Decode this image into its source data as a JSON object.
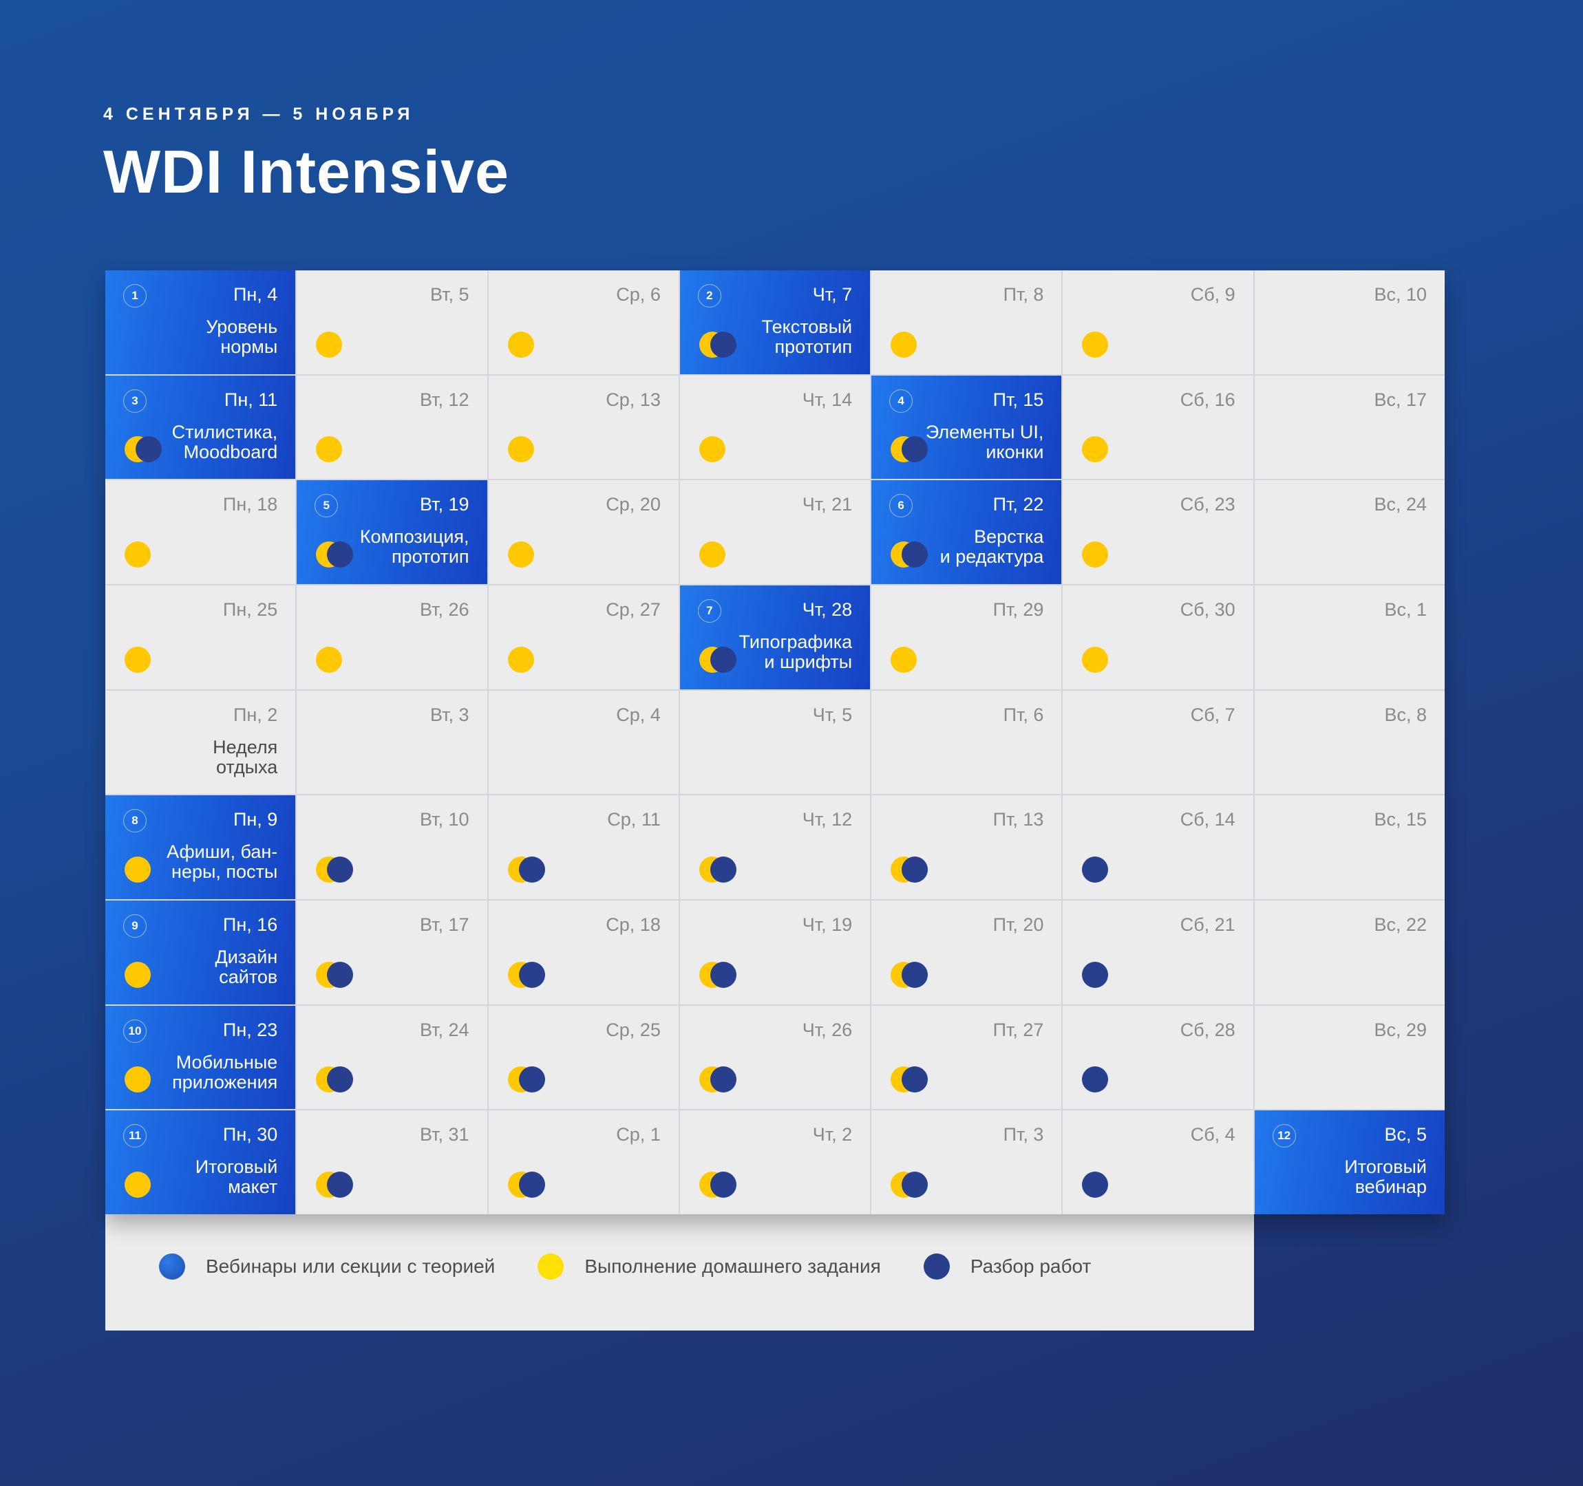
{
  "header": {
    "subtitle": "4 СЕНТЯБРЯ — 5 НОЯБРЯ",
    "title": "WDI Intensive"
  },
  "colors": {
    "lesson_bg": "#1a5ed9",
    "cell_bg": "#ececec",
    "homework_dot": "#ffc800",
    "review_dot": "#273f8c",
    "webinar_dot": "#1b5dc4"
  },
  "legend": [
    {
      "label": "Вебинары или секции с теорией",
      "icon": "webinar-dot"
    },
    {
      "label": "Выполнение домашнего задания",
      "icon": "homework-dot"
    },
    {
      "label": "Разбор работ",
      "icon": "review-dot"
    }
  ],
  "weeks": [
    [
      {
        "date": "Пн, 4",
        "lesson": true,
        "num": "1",
        "title": "Уровень\nнормы",
        "dots": ""
      },
      {
        "date": "Вт, 5",
        "dots": "y"
      },
      {
        "date": "Ср, 6",
        "dots": "y"
      },
      {
        "date": "Чт, 7",
        "lesson": true,
        "num": "2",
        "title": "Текстовый\nпрототип",
        "dots": "yb"
      },
      {
        "date": "Пт, 8",
        "dots": "y"
      },
      {
        "date": "Сб, 9",
        "dots": "y"
      },
      {
        "date": "Вс, 10",
        "dots": ""
      }
    ],
    [
      {
        "date": "Пн, 11",
        "lesson": true,
        "num": "3",
        "title": "Стилистика,\nMoodboard",
        "dots": "yb"
      },
      {
        "date": "Вт, 12",
        "dots": "y"
      },
      {
        "date": "Ср, 13",
        "dots": "y"
      },
      {
        "date": "Чт, 14",
        "dots": "y"
      },
      {
        "date": "Пт, 15",
        "lesson": true,
        "num": "4",
        "title": "Элементы UI,\nиконки",
        "dots": "yb"
      },
      {
        "date": "Сб, 16",
        "dots": "y"
      },
      {
        "date": "Вс, 17",
        "dots": ""
      }
    ],
    [
      {
        "date": "Пн, 18",
        "dots": "y"
      },
      {
        "date": "Вт, 19",
        "lesson": true,
        "num": "5",
        "title": "Композиция,\nпрототип",
        "dots": "yb"
      },
      {
        "date": "Ср, 20",
        "dots": "y"
      },
      {
        "date": "Чт, 21",
        "dots": "y"
      },
      {
        "date": "Пт, 22",
        "lesson": true,
        "num": "6",
        "title": "Верстка\nи редактура",
        "dots": "yb"
      },
      {
        "date": "Сб, 23",
        "dots": "y"
      },
      {
        "date": "Вс, 24",
        "dots": ""
      }
    ],
    [
      {
        "date": "Пн, 25",
        "dots": "y"
      },
      {
        "date": "Вт, 26",
        "dots": "y"
      },
      {
        "date": "Ср, 27",
        "dots": "y"
      },
      {
        "date": "Чт, 28",
        "lesson": true,
        "num": "7",
        "title": "Типографика\nи шрифты",
        "dots": "yb"
      },
      {
        "date": "Пт, 29",
        "dots": "y"
      },
      {
        "date": "Сб, 30",
        "dots": "y"
      },
      {
        "date": "Вс, 1",
        "dots": ""
      }
    ],
    [
      {
        "date": "Пн, 2",
        "rest": true,
        "title": "Неделя\nотдыха",
        "dots": ""
      },
      {
        "date": "Вт, 3",
        "dots": ""
      },
      {
        "date": "Ср, 4",
        "dots": ""
      },
      {
        "date": "Чт, 5",
        "dots": ""
      },
      {
        "date": "Пт, 6",
        "dots": ""
      },
      {
        "date": "Сб, 7",
        "dots": ""
      },
      {
        "date": "Вс, 8",
        "dots": ""
      }
    ],
    [
      {
        "date": "Пн, 9",
        "lesson": true,
        "num": "8",
        "title": "Афиши, бан-\nнеры, посты",
        "dots": "y"
      },
      {
        "date": "Вт, 10",
        "dots": "yb"
      },
      {
        "date": "Ср, 11",
        "dots": "yb"
      },
      {
        "date": "Чт, 12",
        "dots": "yb"
      },
      {
        "date": "Пт, 13",
        "dots": "yb"
      },
      {
        "date": "Сб, 14",
        "dots": "b"
      },
      {
        "date": "Вс, 15",
        "dots": ""
      }
    ],
    [
      {
        "date": "Пн, 16",
        "lesson": true,
        "num": "9",
        "title": "Дизайн\nсайтов",
        "dots": "y"
      },
      {
        "date": "Вт, 17",
        "dots": "yb"
      },
      {
        "date": "Ср, 18",
        "dots": "yb"
      },
      {
        "date": "Чт, 19",
        "dots": "yb"
      },
      {
        "date": "Пт, 20",
        "dots": "yb"
      },
      {
        "date": "Сб, 21",
        "dots": "b"
      },
      {
        "date": "Вс, 22",
        "dots": ""
      }
    ],
    [
      {
        "date": "Пн, 23",
        "lesson": true,
        "num": "10",
        "title": "Мобильные\nприложения",
        "dots": "y"
      },
      {
        "date": "Вт, 24",
        "dots": "yb"
      },
      {
        "date": "Ср, 25",
        "dots": "yb"
      },
      {
        "date": "Чт, 26",
        "dots": "yb"
      },
      {
        "date": "Пт, 27",
        "dots": "yb"
      },
      {
        "date": "Сб, 28",
        "dots": "b"
      },
      {
        "date": "Вс, 29",
        "dots": ""
      }
    ],
    [
      {
        "date": "Пн, 30",
        "lesson": true,
        "num": "11",
        "title": "Итоговый\nмакет",
        "dots": "y"
      },
      {
        "date": "Вт, 31",
        "dots": "yb"
      },
      {
        "date": "Ср, 1",
        "dots": "yb"
      },
      {
        "date": "Чт, 2",
        "dots": "yb"
      },
      {
        "date": "Пт, 3",
        "dots": "yb"
      },
      {
        "date": "Сб, 4",
        "dots": "b"
      },
      {
        "date": "Вс, 5",
        "lesson": true,
        "num": "12",
        "title": "Итоговый\nвебинар",
        "dots": ""
      }
    ]
  ]
}
